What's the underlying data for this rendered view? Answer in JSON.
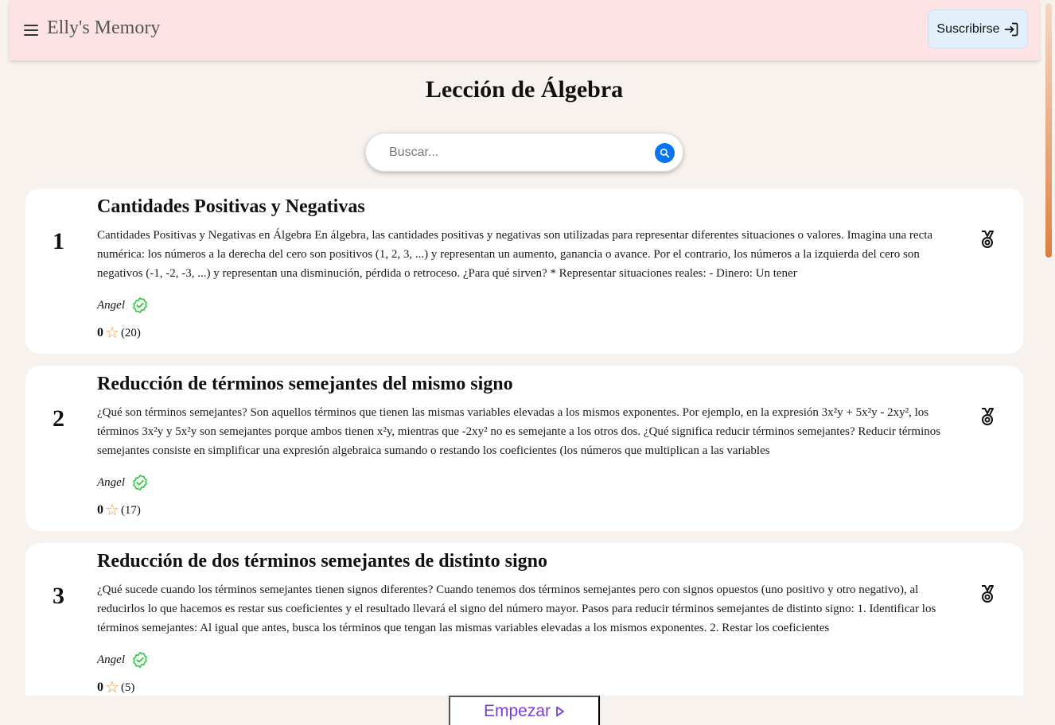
{
  "header": {
    "brand": "Elly's Memory",
    "subscribe_label": "Suscribirse"
  },
  "page": {
    "title": "Lección de Álgebra"
  },
  "search": {
    "placeholder": "Buscar..."
  },
  "lessons": [
    {
      "number": "1",
      "title": "Cantidades Positivas y Negativas",
      "excerpt": "Cantidades Positivas y Negativas en Álgebra En álgebra, las cantidades positivas y negativas son utilizadas para representar diferentes situaciones o valores. Imagina una recta numérica: los números a la derecha del cero son positivos (1, 2, 3, ...) y representan un aumento, ganancia o avance. Por el contrario, los números a la izquierda del cero son negativos (-1, -2, -3, ...) y representan una disminución, pérdida o retroceso. ¿Para qué sirven? * Representar situaciones reales: - Dinero: Un tener",
      "author": "Angel",
      "rating": "0",
      "count": "(20)"
    },
    {
      "number": "2",
      "title": "Reducción de términos semejantes del mismo signo",
      "excerpt": "¿Qué son términos semejantes? Son aquellos términos que tienen las mismas variables elevadas a los mismos exponentes. Por ejemplo, en la expresión 3x²y + 5x²y - 2xy², los términos 3x²y y 5x²y son semejantes porque ambos tienen x²y, mientras que -2xy² no es semejante a los otros dos. ¿Qué significa reducir términos semejantes? Reducir términos semejantes consiste en simplificar una expresión algebraica sumando o restando los coeficientes (los números que multiplican a las variables",
      "author": "Angel",
      "rating": "0",
      "count": "(17)"
    },
    {
      "number": "3",
      "title": "Reducción de dos términos semejantes de distinto signo",
      "excerpt": "¿Qué sucede cuando los términos semejantes tienen signos diferentes? Cuando tenemos dos términos semejantes pero con signos opuestos (uno positivo y otro negativo), al reducirlos lo que hacemos es restar sus coeficientes y el resultado llevará el signo del número mayor. Pasos para reducir términos semejantes de distinto signo: 1. Identificar los términos semejantes: Al igual que antes, busca los términos que tengan las mismas variables elevadas a los mismos exponentes. 2. Restar los coeficientes",
      "author": "Angel",
      "rating": "0",
      "count": "(5)"
    }
  ],
  "footer": {
    "start_label": "Empezar"
  },
  "colors": {
    "header_bg": "#fde3e3",
    "accent_blue": "#0b74f0",
    "star": "#e8952c",
    "verified": "#2ecc40",
    "start_text": "#7a3fd6"
  }
}
